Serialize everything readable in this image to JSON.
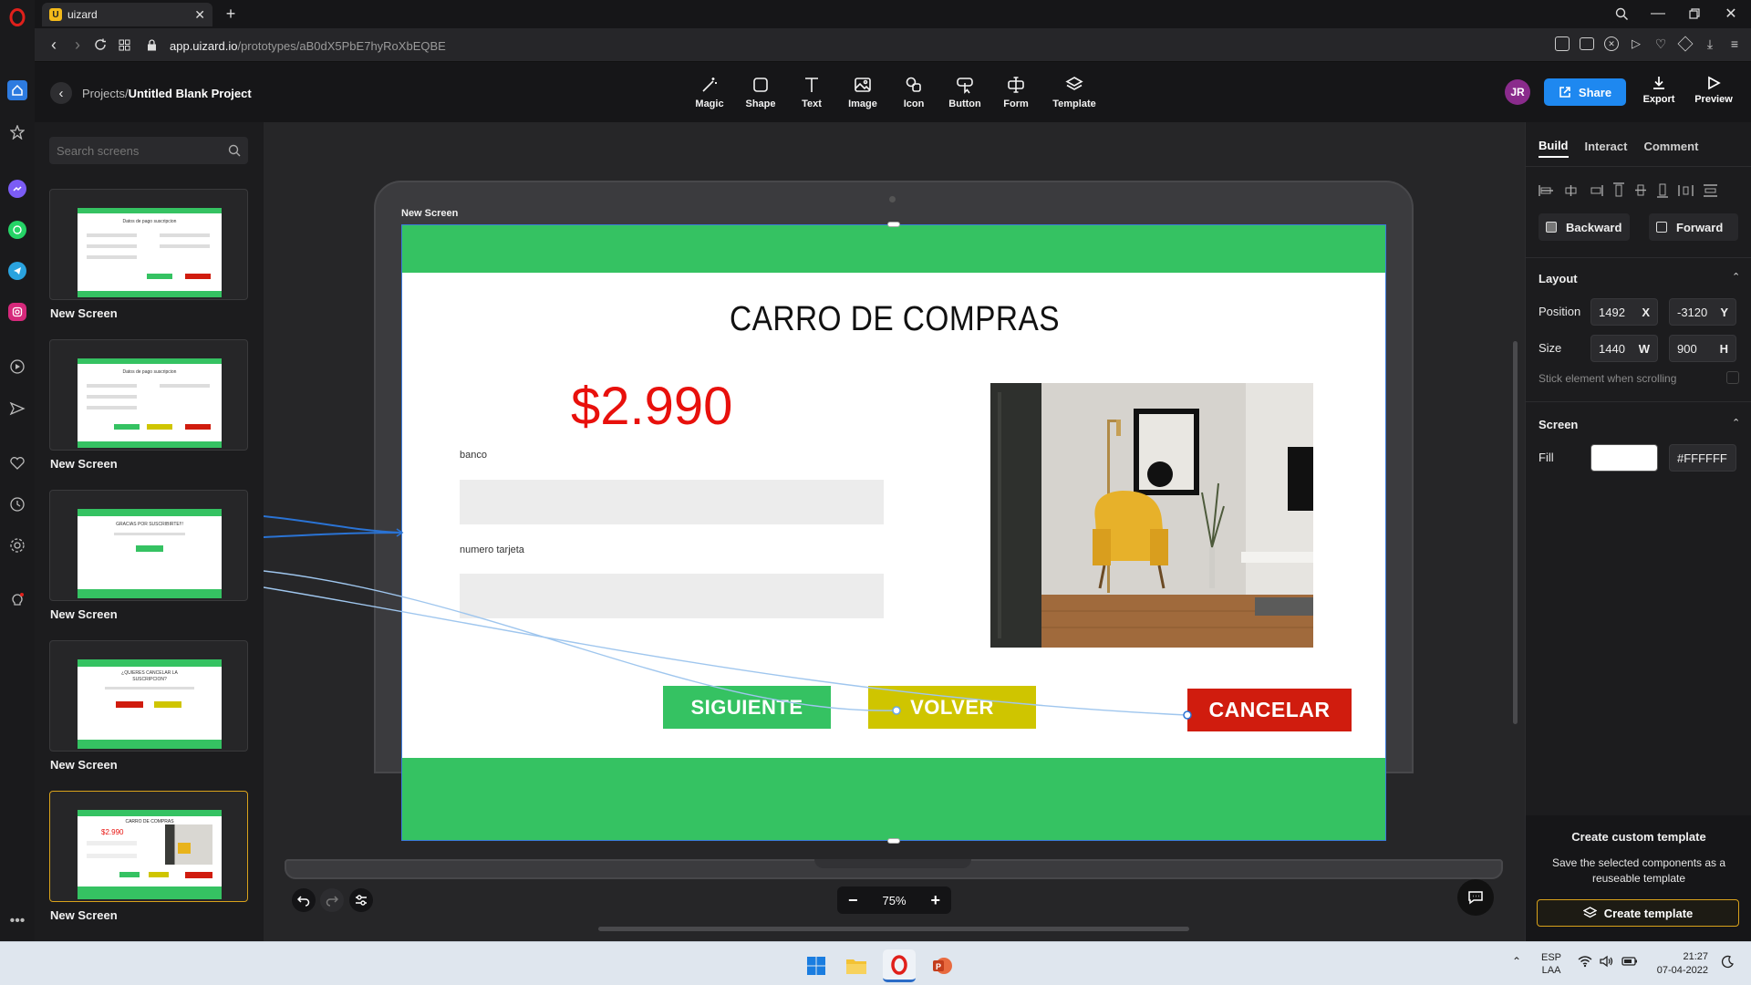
{
  "browser": {
    "tab_title": "uizard",
    "url_host": "app.uizard.io",
    "url_path": "/prototypes/aB0dX5PbE7hyRoXbEQBE"
  },
  "app": {
    "breadcrumb_projects": "Projects",
    "breadcrumb_sep": "/",
    "project_name": "Untitled Blank Project",
    "tools": [
      {
        "label": "Magic",
        "icon": "magic-wand-icon"
      },
      {
        "label": "Shape",
        "icon": "shape-icon"
      },
      {
        "label": "Text",
        "icon": "text-icon"
      },
      {
        "label": "Image",
        "icon": "image-icon"
      },
      {
        "label": "Icon",
        "icon": "icon-shapes-icon"
      },
      {
        "label": "Button",
        "icon": "button-pointer-icon"
      },
      {
        "label": "Form",
        "icon": "form-icon"
      },
      {
        "label": "Template",
        "icon": "layers-icon"
      }
    ],
    "avatar_initials": "JR",
    "share_label": "Share",
    "export_label": "Export",
    "preview_label": "Preview"
  },
  "screens_panel": {
    "search_placeholder": "Search screens",
    "screens": [
      {
        "label": "New Screen",
        "mini_title": "Datos de pago suscripcion"
      },
      {
        "label": "New Screen",
        "mini_title": "Datos de pago suscripcion"
      },
      {
        "label": "New Screen",
        "mini_title": "GRACIAS POR SUSCRIBIRTE!!!"
      },
      {
        "label": "New Screen",
        "mini_title": "¿QUIERES CANCELAR LA SUSCRIPCION?"
      },
      {
        "label": "New Screen",
        "mini_title": "CARRO DE COMPRAS"
      }
    ]
  },
  "canvas": {
    "frame_label": "New Screen",
    "screen": {
      "title": "CARRO DE COMPRAS",
      "price": "$2.990",
      "field1_label": "banco",
      "field2_label": "numero tarjeta",
      "btn_next": "SIGUIENTE",
      "btn_back": "VOLVER",
      "btn_cancel": "CANCELAR"
    },
    "zoom": "75%",
    "colors": {
      "green": "#35c262",
      "yellow": "#cfc500",
      "red": "#d01c0e",
      "price": "#e8100c"
    }
  },
  "properties": {
    "tabs": [
      "Build",
      "Interact",
      "Comment"
    ],
    "active_tab": "Build",
    "backward_label": "Backward",
    "forward_label": "Forward",
    "layout_title": "Layout",
    "position_label": "Position",
    "pos_x": "1492",
    "pos_x_unit": "X",
    "pos_y": "-3120",
    "pos_y_unit": "Y",
    "size_label": "Size",
    "size_w": "1440",
    "size_w_unit": "W",
    "size_h": "900",
    "size_h_unit": "H",
    "stick_label": "Stick element when scrolling",
    "screen_title": "Screen",
    "fill_label": "Fill",
    "fill_value": "#FFFFFF",
    "template_heading": "Create custom template",
    "template_desc": "Save the selected components as a reuseable template",
    "template_button": "Create template"
  },
  "taskbar": {
    "lang1": "ESP",
    "lang2": "LAA",
    "time": "21:27",
    "date": "07-04-2022"
  }
}
